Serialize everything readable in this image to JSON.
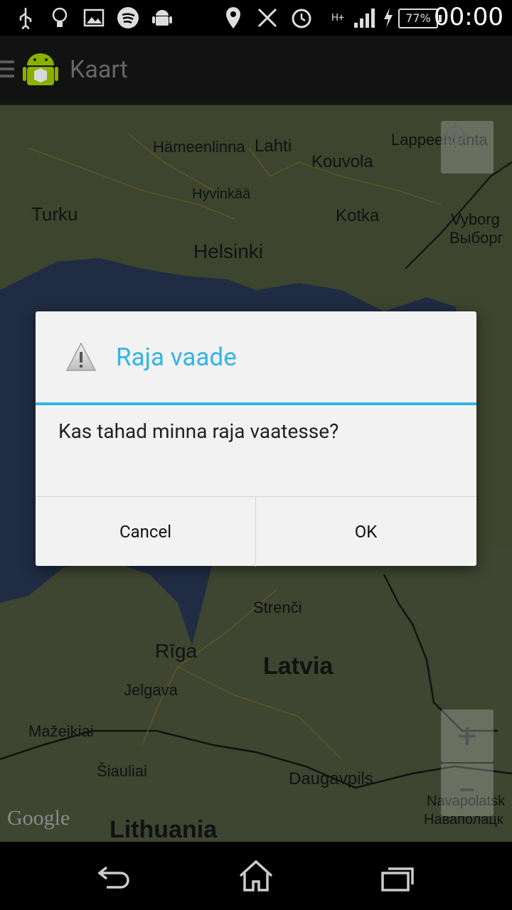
{
  "status_bar": {
    "time": "00:00",
    "battery": "77%",
    "network": "H+",
    "icons": [
      "usb-icon",
      "lightbulb-icon",
      "image-icon",
      "spotify-icon",
      "android-icon",
      "location-icon",
      "nfc-icon",
      "alarm-icon",
      "signal-icon",
      "charging-icon",
      "battery-icon"
    ]
  },
  "action_bar": {
    "title": "Kaart"
  },
  "map": {
    "labels": {
      "hameenlinna": "Hämeenlinna",
      "lahti": "Lahti",
      "kouvola": "Kouvola",
      "lappeenranta": "Lappeenranta",
      "hyvinkaa": "Hyvinkää",
      "turku": "Turku",
      "kotka": "Kotka",
      "vyborg": "Vyborg",
      "vyborg_ru": "Выборг",
      "helsinki": "Helsinki",
      "strenci": "Strenči",
      "riga": "Rīga",
      "latvia": "Latvia",
      "jelgava": "Jelgava",
      "mazeikiai": "Mažeikiai",
      "siauliai": "Šiauliai",
      "daugavpils": "Daugavpils",
      "lithuania": "Lithuania",
      "navapolatsk": "Navapolatsk",
      "navapolatsk_by": "Наваполацк"
    },
    "google_logo": "Google",
    "zoom_in": "+",
    "zoom_out": "−"
  },
  "dialog": {
    "title": "Raja vaade",
    "message": "Kas tahad minna raja vaatesse?",
    "cancel": "Cancel",
    "ok": "OK"
  },
  "colors": {
    "accent": "#33b5e5",
    "dialog_bg": "#f2f2f2"
  }
}
